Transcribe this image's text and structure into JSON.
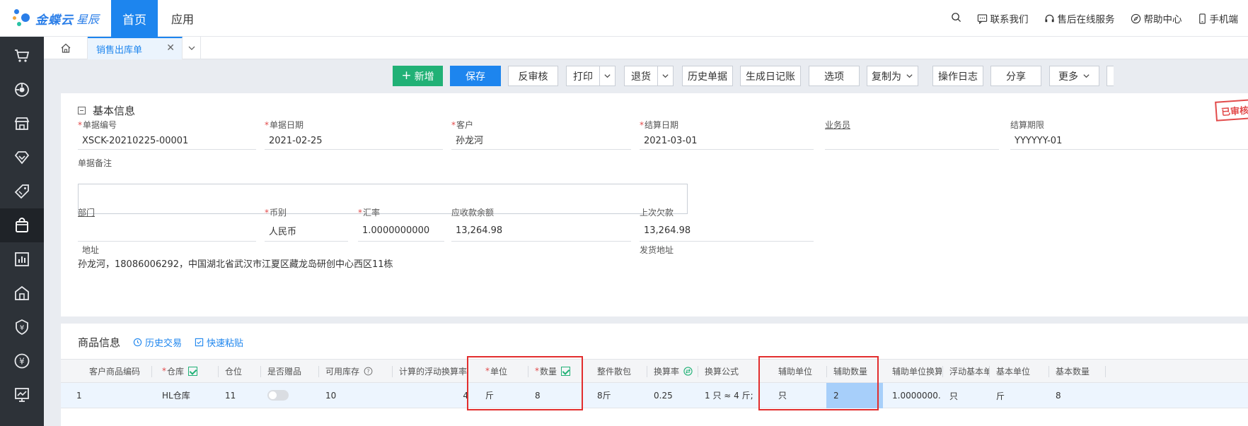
{
  "app": {
    "logo_text": "金蝶云",
    "logo_sub": "星辰",
    "nav_home": "首页",
    "nav_app": "应用"
  },
  "top_right": {
    "contact": "联系我们",
    "service": "售后在线服务",
    "help": "帮助中心",
    "mobile": "手机端"
  },
  "tabs": {
    "doc_tab": "销售出库单"
  },
  "toolbar": {
    "add": "新增",
    "save": "保存",
    "unaudit": "反审核",
    "print": "打印",
    "return": "退货",
    "history": "历史单据",
    "journal": "生成日记账",
    "options": "选项",
    "copy_as": "复制为",
    "log": "操作日志",
    "share": "分享",
    "more": "更多"
  },
  "basic": {
    "title": "基本信息",
    "stamp": "已审核",
    "fields": {
      "bill_no": {
        "label": "单据编号",
        "value": "XSCK-20210225-00001"
      },
      "bill_date": {
        "label": "单据日期",
        "value": "2021-02-25"
      },
      "customer": {
        "label": "客户",
        "value": "孙龙河"
      },
      "settle_date": {
        "label": "结算日期",
        "value": "2021-03-01"
      },
      "salesman": {
        "label": "业务员",
        "value": ""
      },
      "settle_period": {
        "label": "结算期限",
        "value": "YYYYYY-01"
      },
      "remark": {
        "label": "单据备注",
        "value": ""
      },
      "dept": {
        "label": "部门",
        "value": ""
      },
      "currency": {
        "label": "币别",
        "value": "人民币"
      },
      "rate": {
        "label": "汇率",
        "value": "1.0000000000"
      },
      "receivable": {
        "label": "应收款余额",
        "value": "13,264.98"
      },
      "last_debt": {
        "label": "上次欠款",
        "value": "13,264.98"
      },
      "address": {
        "label": "地址",
        "value": "孙龙河，18086006292，中国湖北省武汉市江夏区藏龙岛研创中心西区11栋"
      },
      "ship_addr": {
        "label": "发货地址",
        "value": ""
      }
    }
  },
  "goods": {
    "title": "商品信息",
    "history_link": "历史交易",
    "paste_link": "快速粘贴",
    "columns": {
      "cust_code": "客户商品编码",
      "warehouse": "仓库",
      "location": "仓位",
      "gift": "是否赠品",
      "stock": "可用库存",
      "float_rate": "计算的浮动换算率",
      "unit": "单位",
      "qty": "数量",
      "pack": "整件散包",
      "conv_rate": "换算率",
      "formula": "换算公式",
      "aux_unit": "辅助单位",
      "aux_qty": "辅助数量",
      "aux_conv": "辅助单位换算",
      "float_base": "浮动基本单",
      "base_unit": "基本单位",
      "base_qty": "基本数量"
    },
    "rows": [
      {
        "no": "1",
        "cust_code": "",
        "warehouse": "HL仓库",
        "location": "11",
        "stock": "10",
        "float_rate": "4",
        "unit": "斤",
        "qty": "8",
        "pack": "8斤",
        "conv_rate": "0.25",
        "formula": "1 只 ≈ 4 斤;",
        "aux_unit": "只",
        "aux_qty": "2",
        "aux_conv": "1.0000000...",
        "float_base": "只",
        "base_unit": "斤",
        "base_qty": "8"
      }
    ]
  }
}
